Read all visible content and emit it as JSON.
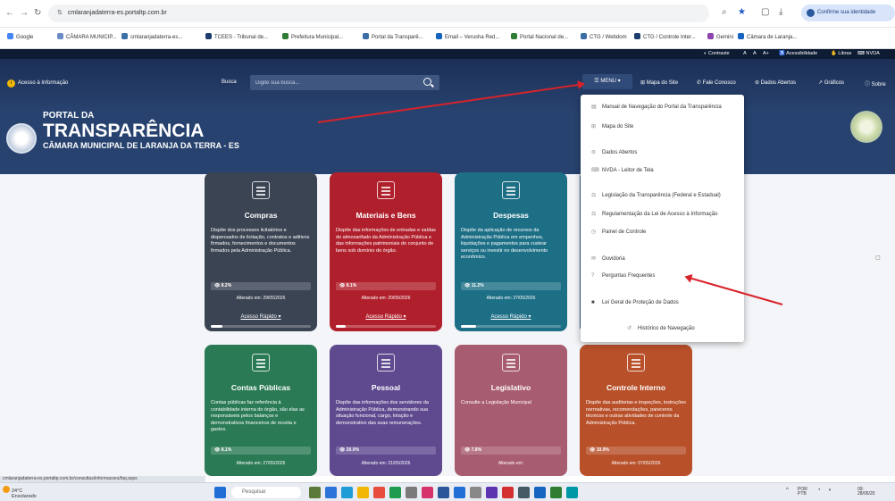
{
  "browser": {
    "url": "cmlaranjadaterra-es.portaltp.com.br",
    "profile_label": "Confirme sua identidade"
  },
  "bookmarks": [
    "Google",
    "CÂMARA MUNICIP...",
    "cmlaranjadaterra-es...",
    "TCEES - Tribunal de...",
    "Prefeitura Municipal...",
    "Portal da Transparê...",
    "Email – Verusha Red...",
    "Portal Nacional de...",
    "CTG / Webdom",
    "CTG / Controle Inter...",
    "Gemini",
    "Câmara de Laranja..."
  ],
  "accessibility_bar": [
    "Contraste",
    "A",
    "A",
    "A+",
    "Acessibilidade",
    "Libras",
    "NVDA"
  ],
  "nav": {
    "info": "Acesso à Informação",
    "busca_label": "Busca",
    "search_placeholder": "Digite sua busca...",
    "menu": "MENU",
    "links": [
      "Mapa do Site",
      "Fale Conosco",
      "Dados Abertos",
      "Gráficos",
      "Sobre"
    ]
  },
  "header": {
    "small": "PORTAL DA",
    "big": "TRANSPARÊNCIA",
    "sub": "CÂMARA MUNICIPAL DE LARANJA DA TERRA - ES"
  },
  "cards": [
    {
      "title": "Compras",
      "desc": "Dispõe dos processos licitatórios e dispensados de licitação, contratos e aditivos firmados, fornecimentos e documentos firmados pela Administração Pública.",
      "pill": "8.2%",
      "date": "Alterado em: 29/05/2026",
      "fast": "Acesso Rápido",
      "progress": 0.12,
      "color": "#3b4453"
    },
    {
      "title": "Materiais e Bens",
      "desc": "Dispõe das informações de entradas e saídas do almoxarifado da Administração Pública e das informações patrimoniais do conjunto de bens sob domínio do órgão.",
      "pill": "8.1%",
      "date": "Alterado em: 20/05/2026",
      "fast": "Acesso Rápido",
      "progress": 0.1,
      "color": "#b0202c"
    },
    {
      "title": "Despesas",
      "desc": "Dispõe da aplicação de recursos da Administração Pública em empenhos, liquidações e pagamentos para custear serviços ou investir no desenvolvimento econômico.",
      "pill": "11.2%",
      "date": "Alterado em: 27/05/2026",
      "fast": "Acesso Rápido",
      "progress": 0.15,
      "color": "#1d6f86"
    },
    {
      "title": "Contas Públicas",
      "desc": "Contas públicas faz referência à contabilidade interna do órgão, são elas as responsáveis pelos balanços e demonstrativos financeiros de receita e gastos.",
      "pill": "8.1%",
      "date": "Alterado em: 27/05/2026",
      "fast": "",
      "progress": 0.1,
      "color": "#2a7a55"
    },
    {
      "title": "Pessoal",
      "desc": "Dispõe das informações dos servidores da Administração Pública, demonstrando sua situação funcional, cargo, lotação e demonstrativo das suas remunerações.",
      "pill": "20.0%",
      "date": "Alterado em: 21/05/2026",
      "fast": "",
      "progress": 0.2,
      "color": "#5f4a8f"
    },
    {
      "title": "Legislativo",
      "desc": "Consulte a Legislação Municipal",
      "pill": "7.8%",
      "date": "Alterado em:",
      "fast": "",
      "progress": 0.1,
      "color": "#a85c6f"
    },
    {
      "title": "Controle Interno",
      "desc": "Dispõe das auditorias e inspeções, instruções normativas, recomendações, pareceres técnicos e outras atividades de controle da Administração Pública.",
      "pill": "10.9%",
      "date": "Alterado em: 07/05/2026",
      "fast": "",
      "progress": 0.13,
      "color": "#b8502a"
    }
  ],
  "menu_items": [
    {
      "icon": "book",
      "label": "Manual de Navegação do Portal da Transparência"
    },
    {
      "icon": "sitemap",
      "label": "Mapa do Site"
    },
    {
      "icon": "database",
      "label": "Dados Abertos"
    },
    {
      "icon": "keyboard",
      "label": "NVDA - Leitor de Tela"
    },
    {
      "icon": "scale",
      "label": "Legislação da Transparência (Federal e Estadual)"
    },
    {
      "icon": "scale",
      "label": "Regulamentação da Lei de Acesso à Informação"
    },
    {
      "icon": "dashboard",
      "label": "Painel de Controle"
    },
    {
      "icon": "megaphone",
      "label": "Ouvidoria"
    },
    {
      "icon": "question",
      "label": "Perguntas Frequentes"
    },
    {
      "icon": "lock",
      "label": "Lei Geral de Proteção de Dados"
    },
    {
      "icon": "history",
      "label": "Histórico de Navegação"
    }
  ],
  "status_url": "cmlaranjadaterra-es.portaltp.com.br/consultas/informacoes/faq.aspx",
  "taskbar": {
    "weather_temp": "24°C",
    "weather_desc": "Ensolarado",
    "search": "Pesquisar",
    "tray_lang": "POR",
    "tray_layout": "PTB",
    "time": "09:",
    "date": "28/05/20"
  }
}
